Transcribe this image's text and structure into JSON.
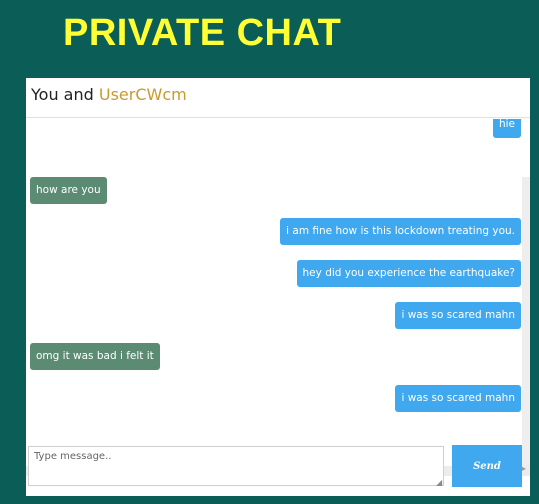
{
  "page": {
    "title": "PRIVATE CHAT"
  },
  "chat": {
    "header_prefix": "You and",
    "username": "UserCWcm"
  },
  "messages": [
    {
      "text": "hie",
      "direction": "out"
    },
    {
      "text": "how are you",
      "direction": "in"
    },
    {
      "text": "i am fine how is this lockdown treating you.",
      "direction": "out"
    },
    {
      "text": "hey did you experience the earthquake?",
      "direction": "out"
    },
    {
      "text": "i was so scared mahn",
      "direction": "out"
    },
    {
      "text": "omg it was bad i felt it",
      "direction": "in"
    },
    {
      "text": "i was so scared mahn",
      "direction": "out"
    }
  ],
  "composer": {
    "placeholder": "Type message..",
    "value": "",
    "send_label": "Send"
  },
  "colors": {
    "background": "#0b5e58",
    "title": "#ffff33",
    "outgoing": "#3fa8ee",
    "incoming": "#5b8c73",
    "username": "#c99a2e"
  }
}
